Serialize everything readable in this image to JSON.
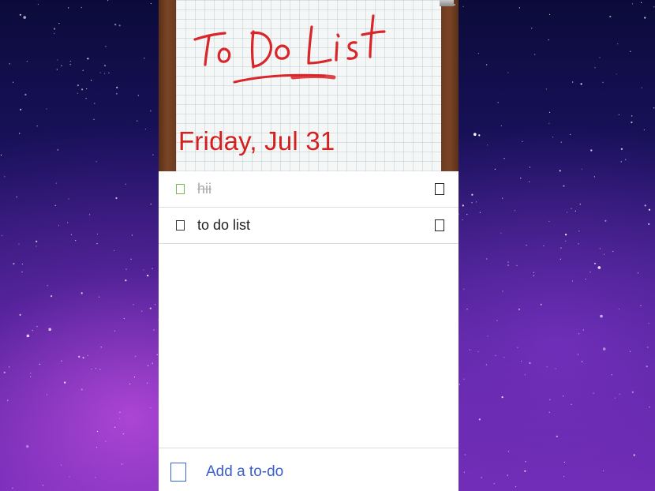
{
  "header": {
    "image_text": "To Do List",
    "date": "Friday, Jul 31"
  },
  "todos": [
    {
      "text": "hii",
      "done": true
    },
    {
      "text": "to do list",
      "done": false
    }
  ],
  "footer": {
    "add_placeholder": "Add a to-do"
  },
  "colors": {
    "date": "#d4201f",
    "accent": "#3a5fcd",
    "done_checkbox": "#7ab648"
  },
  "icons": {
    "checkbox": "checkbox-icon",
    "delete": "trash-icon",
    "add": "add-checkbox-icon"
  }
}
